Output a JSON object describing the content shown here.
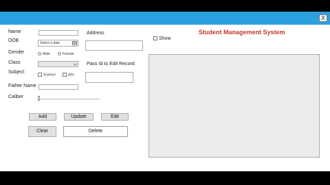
{
  "window": {
    "close_label": "X"
  },
  "form": {
    "name_label": "Name",
    "dob_label": "DOB",
    "dob_placeholder": "Select a date",
    "gender_label": "Gender",
    "gender_male": "Male",
    "gender_female": "Female",
    "class_label": "Class",
    "class_value": "",
    "subject_label": "Subject",
    "subject_science": "Science",
    "subject_arts": "Arts",
    "father_name_label": "Father Name",
    "caliber_label": "Caliber",
    "caliber_value": 0
  },
  "address_label": "Address",
  "pass_id_label": "Pass Id to Edit Record",
  "buttons": {
    "add": "Add",
    "update": "Update",
    "edit": "Edit",
    "clear": "Clear",
    "delete": "Delete"
  },
  "show_label": "Show",
  "app_title": "Student Management System"
}
